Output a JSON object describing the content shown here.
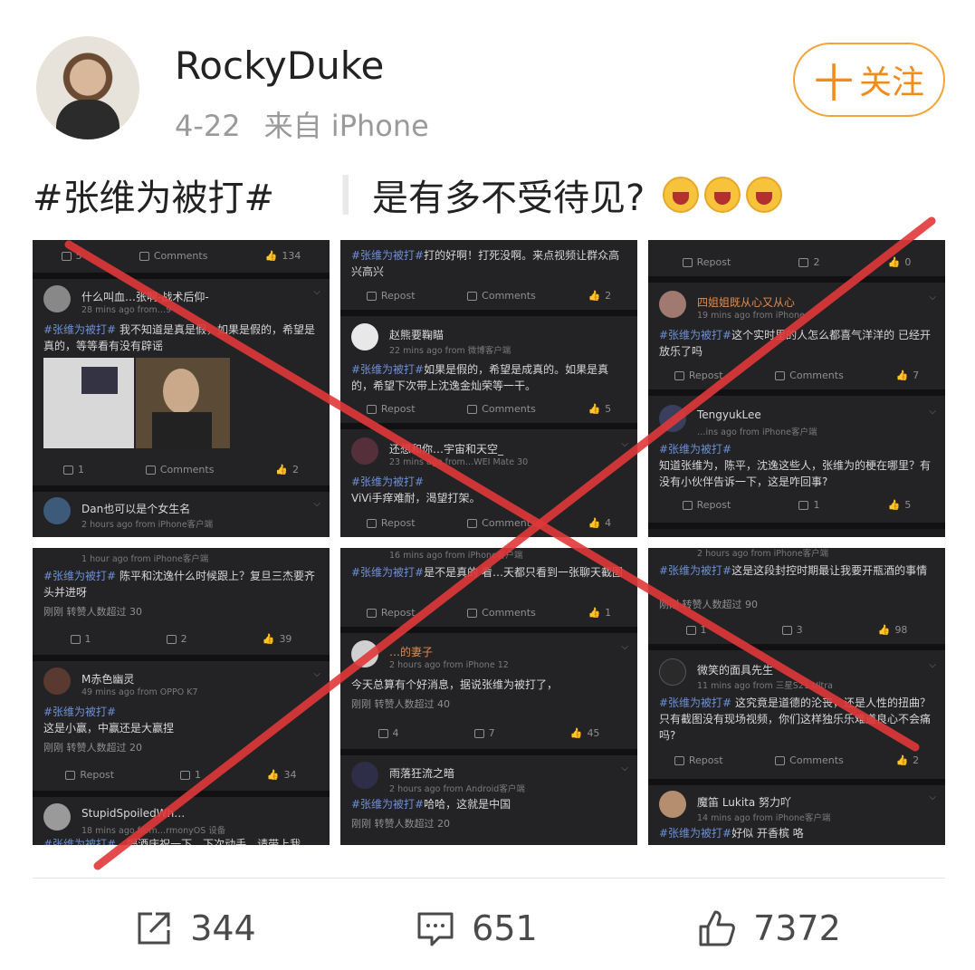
{
  "header": {
    "username": "RockyDuke",
    "date": "4-22",
    "source": "来自 iPhone",
    "follow_label": "关注",
    "follow_plus": "十"
  },
  "post": {
    "hashtag": "#张维为被打#",
    "text": "是有多不受待见?",
    "emojis": [
      "laugh-emoji",
      "laugh-emoji",
      "laugh-emoji"
    ]
  },
  "panels": {
    "p1": {
      "top_actions": [
        "5",
        "Comments",
        "134"
      ],
      "c1": {
        "user": "什么叫血…张啊-战术后仰-",
        "time": "28 mins ago  from…9",
        "text_tag": "#张维为被打#",
        "text": " 我不知道是真是假，如果是假的，希望是真的，等等看有没有辟谣",
        "actions": [
          "1",
          "Comments",
          "2"
        ]
      },
      "c2": {
        "user": "Dan也可以是个女生名",
        "time": "2 hours ago  from iPhone客户端"
      }
    },
    "p2": {
      "c0": {
        "text_tag": "#张维为被打#",
        "text": "打的好啊！打死没啊。来点视频让群众高兴高兴",
        "actions": [
          "Repost",
          "Comments",
          "2"
        ]
      },
      "c1": {
        "user": "赵熊要鞠瞄",
        "time": "22 mins ago  from 微博客户端",
        "text_tag": "#张维为被打#",
        "text": "如果是假的，希望是成真的。如果是真的，希望下次带上沈逸金灿荣等一干。",
        "actions": [
          "Repost",
          "Comments",
          "5"
        ]
      },
      "c2": {
        "user": "还想和你…宇宙和天空_",
        "time": "23 mins ago  from…WEI Mate 30",
        "text_tag": "#张维为被打#",
        "text": "ViVi手痒难耐，渴望打架。",
        "actions": [
          "Repost",
          "Comments",
          "4"
        ]
      }
    },
    "p3": {
      "top_actions": [
        "Repost",
        "2",
        "0"
      ],
      "c1": {
        "user": "四姐姐既从心又从心",
        "time": "19 mins ago  from iPhone",
        "text_tag": "#张维为被打#",
        "text": "这个实时里的人怎么都喜气洋洋的 已经开放乐了吗",
        "actions": [
          "Repost",
          "Comments",
          "7"
        ]
      },
      "c2": {
        "user": "TengyukLee",
        "time": "…ins ago  from iPhone客户端",
        "text_tag": "#张维为被打#",
        "text": "知道张维为，陈平，沈逸这些人，张维为的梗在哪里？有没有小伙伴告诉一下，这是咋回事?",
        "actions": [
          "Repost",
          "1",
          "5"
        ]
      }
    },
    "p4": {
      "c0": {
        "time": "1 hour ago  from iPhone客户端",
        "text_tag": "#张维为被打#",
        "text": " 陈平和沈逸什么时候跟上？复旦三杰要齐头并进呀",
        "note": "刚刚 转赞人数超过 30",
        "actions": [
          "1",
          "2",
          "39"
        ]
      },
      "c1": {
        "user": "M赤色幽灵",
        "time": "49 mins ago  from OPPO K7",
        "text_tag": "#张维为被打#",
        "text": "这是小赢，中赢还是大赢捏",
        "note": "刚刚 转赞人数超过 20",
        "actions": [
          "Repost",
          "1",
          "34"
        ]
      },
      "c2": {
        "user": "StupidSpoiledWh…",
        "time": "18 mins ago  from…rmonyOS 设备",
        "text_tag": "#张维为被打#",
        "text": "…喝酒庆祝一下，下次动手，请带上我"
      }
    },
    "p5": {
      "c0": {
        "time": "16 mins ago  from iPhone客户端",
        "text_tag": "#张维为被打#",
        "text": "是不是真的 看…天都只看到一张聊天截图",
        "actions": [
          "Repost",
          "Comments",
          "1"
        ]
      },
      "c1": {
        "user": "…的妻子",
        "time": "2 hours ago  from iPhone 12",
        "text": "今天总算有个好消息，据说张维为被打了，",
        "note": "刚刚 转赞人数超过 40",
        "actions": [
          "4",
          "7",
          "45"
        ]
      },
      "c2": {
        "user": "雨落狂流之暗",
        "time": "2 hours ago  from Android客户端",
        "text_tag": "#张维为被打#",
        "text": "哈哈，这就是中国",
        "note": "刚刚 转赞人数超过 20"
      }
    },
    "p6": {
      "c0": {
        "time": "2 hours ago  from iPhone客户端",
        "text_tag": "#张维为被打#",
        "text": "这是这段封控时期最让我要开瓶酒的事情",
        "note": "刚刚 转赞人数超过 90",
        "actions": [
          "1",
          "3",
          "98"
        ]
      },
      "c1": {
        "user": "微笑的面具先生",
        "time": "11 mins ago  from 三星S21 Ultra",
        "text_tag": "#张维为被打#",
        "text": " 这究竟是道德的沦丧，还是人性的扭曲？只有截图没有现场视频，你们这样独乐乐难道良心不会痛吗?",
        "actions": [
          "Repost",
          "Comments",
          "2"
        ]
      },
      "c2": {
        "user": "魔笛 Lukita 努力吖",
        "time": "14 mins ago  from iPhone客户端",
        "text_tag": "#张维为被打#",
        "text": "好似 开香槟 咯"
      }
    }
  },
  "footer": {
    "repost_count": "344",
    "comment_count": "651",
    "like_count": "7372"
  },
  "colors": {
    "follow": "#f08c1b",
    "cross": "#e0383a",
    "hashtag_dark": "#6d8fd6"
  }
}
